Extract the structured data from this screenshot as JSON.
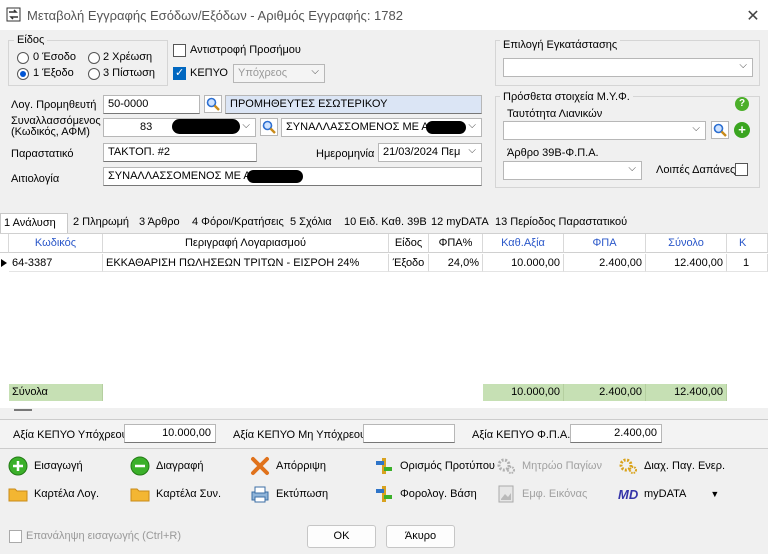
{
  "window": {
    "title": "Μεταβολή Εγγραφής Εσόδων/Εξόδων - Αριθμός Εγγραφής: 1782"
  },
  "eidos": {
    "title": "Είδος",
    "options": [
      "0 Έσοδο",
      "2 Χρέωση",
      "1 Έξοδο",
      "3 Πίστωση"
    ],
    "selected": "1 Έξοδο"
  },
  "reverse_sign": {
    "label": "Αντιστροφή Προσήμου",
    "checked": false
  },
  "kepyo": {
    "label": "ΚΕΠΥΟ",
    "checked": true,
    "value": "Υπόχρεος"
  },
  "form": {
    "supplier_label": "Λογ. Προμηθευτή",
    "supplier_code": "50-0000",
    "supplier_name": "ΠΡΟΜΗΘΕΥΤΕΣ ΕΣΩΤΕΡΙΚΟΥ",
    "counterparty_label": "Συναλλασσόμενος\n(Κωδικός, ΑΦΜ)",
    "counterparty_code": "83",
    "counterparty_name": "ΣΥΝΑΛΛΑΣΣΟΜΕΝΟΣ ΜΕ ΑΦΜ",
    "document_label": "Παραστατικό",
    "document_value": "ΤΑΚΤΟΠ. #2",
    "date_label": "Ημερομηνία",
    "date_value": "21/03/2024 Πεμ",
    "reason_label": "Αιτιολογία",
    "reason_value": "ΣΥΝΑΛΛΑΣΣΟΜΕΝΟΣ ΜΕ ΑΦΜ"
  },
  "installation": {
    "title": "Επιλογή Εγκατάστασης",
    "value": ""
  },
  "myf": {
    "title": "Πρόσθετα στοιχεία Μ.Υ.Φ.",
    "retail_id_label": "Ταυτότητα Λιανικών",
    "retail_id_value": "",
    "article_label": "Άρθρο 39Β-Φ.Π.Α.",
    "article_value": "",
    "other_expenses_label": "Λοιπές Δαπάνες",
    "other_expenses_checked": false
  },
  "tabs": [
    "1 Ανάλυση",
    "2 Πληρωμή",
    "3 Άρθρο",
    "4 Φόροι/Κρατήσεις",
    "5 Σχόλια",
    "10 Ειδ. Καθ. 39Β",
    "12 myDATA",
    "13 Περίοδος Παραστατικού"
  ],
  "active_tab": "1 Ανάλυση",
  "grid": {
    "headers": [
      "Κωδικός",
      "Περιγραφή Λογαριασμού",
      "Είδος",
      "ΦΠΑ%",
      "Καθ.Αξία",
      "ΦΠΑ",
      "Σύνολο",
      "Κ"
    ],
    "rows": [
      [
        "64-3387",
        "ΕΚΚΑΘΑΡΙΣΗ ΠΩΛΗΣΕΩΝ ΤΡΙΤΩΝ - ΕΙΣΡΟΗ 24%",
        "Έξοδο",
        "24,0%",
        "10.000,00",
        "2.400,00",
        "12.400,00",
        "1"
      ]
    ],
    "totals_label": "Σύνολα",
    "totals": {
      "net": "10.000,00",
      "vat": "2.400,00",
      "total": "12.400,00"
    }
  },
  "summary": {
    "liable_label": "Αξία ΚΕΠΥΟ Υπόχρεου",
    "liable_value": "10.000,00",
    "nonliable_label": "Αξία ΚΕΠΥΟ Μη Υπόχρεου",
    "nonliable_value": "",
    "vat_label": "Αξία ΚΕΠΥΟ Φ.Π.Α.",
    "vat_value": "2.400,00"
  },
  "toolbar": {
    "insert": "Εισαγωγή",
    "delete": "Διαγραφή",
    "reject": "Απόρριψη",
    "template": "Ορισμός Προτύπου",
    "assets": "Μητρώο Παγίων",
    "asset_mgmt": "Διαχ. Παγ. Ενερ.",
    "account_card": "Καρτέλα Λογ.",
    "counterparty_card": "Καρτέλα Συν.",
    "print": "Εκτύπωση",
    "tax_base": "Φορολογ. Βάση",
    "show_image": "Εμφ. Εικόνας",
    "mydata_logo": "MD",
    "mydata": "myDATA"
  },
  "footer": {
    "repeat_label": "Επανάληψη εισαγωγής (Ctrl+R)",
    "ok": "OK",
    "cancel": "Άκυρο"
  },
  "colors": {
    "accent": "#0067c0",
    "total_green": "#c6e0b4",
    "header_blue": "#2a57c9",
    "field_blue": "#dbe5f5"
  }
}
